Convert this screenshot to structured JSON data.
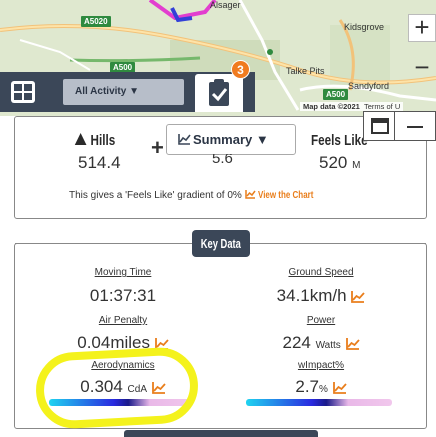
{
  "map": {
    "places": [
      "Kidsgrove",
      "Talke Pits",
      "Sandyford"
    ],
    "town_label": "Alsager",
    "roads": [
      "A5020",
      "A500",
      "A500"
    ],
    "attribution": {
      "map_data": "Map data ©2021",
      "terms": "Terms of U"
    },
    "zoom_in": "+",
    "zoom_out": "−"
  },
  "toolbar": {
    "activity_select": "All Activity ▼",
    "badge_count": "3"
  },
  "summary": {
    "hills_label": "Hills",
    "hills_value": "514.4",
    "select_label": "Summary ▼",
    "middle_value": "5.6",
    "feels_label": "Feels Like",
    "feels_value": "520",
    "feels_unit": "M",
    "note_text": "This gives a 'Feels Like' gradient of 0%",
    "view_chart": "View the Chart"
  },
  "key_data": {
    "button_label": "Key Data",
    "metrics": [
      {
        "label": "Moving Time",
        "value": "01:37:31",
        "unit": ""
      },
      {
        "label": "Ground Speed",
        "value": "34.1km/h",
        "unit": ""
      },
      {
        "label": "Air Penalty",
        "value": "0.04miles",
        "unit": ""
      },
      {
        "label": "Power",
        "value": "224",
        "unit": "Watts"
      },
      {
        "label": "Aerodynamics",
        "value": "0.304",
        "unit": "CdA"
      },
      {
        "label": "wImpact%",
        "value": "2.7",
        "unit": "%"
      }
    ]
  },
  "colors": {
    "toolbar": "#3b4758",
    "accent_orange": "#e97e1c",
    "badge": "#f07b1f",
    "highlight": "#f4f21c"
  }
}
